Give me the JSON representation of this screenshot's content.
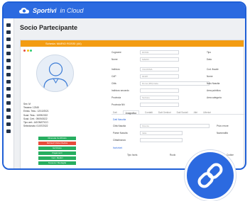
{
  "brand": {
    "name_bold": "Sportivi",
    "name_light": "in Cloud"
  },
  "page": {
    "title": "Socio Partecipante"
  },
  "panel": {
    "header": "Scheda: MARIO ROSSI (44)",
    "dot_colors": [
      "#e74c3c",
      "#f1c40f",
      "#2ecc71"
    ]
  },
  "profile": {
    "info": [
      "Sex: M",
      "Tessera: 12345",
      "Emiss. Tess.: 12/10/2021",
      "Scad. Tess.: 10/09/2022",
      "Scad. Cert.: 09/09/2022",
      "Tipo cert.: AGONISTICO",
      "Selezionato: 01/07/2022"
    ],
    "buttons": [
      {
        "label": "Ricevuta Certificato",
        "color": "#27ae60"
      },
      {
        "label": "Richiedi Visita Medica",
        "color": "#e74c3c"
      },
      {
        "label": "Iscrizione",
        "color": "#27ae60"
      },
      {
        "label": "Pagamenti",
        "color": "#27ae60"
      },
      {
        "label": "Cert. Medici",
        "color": "#27ae60"
      },
      {
        "label": "Tessera / Medaglia",
        "color": "#27ae60"
      }
    ]
  },
  "form": {
    "fields": [
      {
        "label": "Cognome",
        "value": "ROSSI"
      },
      {
        "label": "Nome",
        "value": "MARIO"
      },
      {
        "label": "Indirizzo",
        "value": "VIA ROMA"
      },
      {
        "label": "CAP",
        "value": "00187"
      },
      {
        "label": "Città",
        "value": "Roma (RM) Italia"
      },
      {
        "label": "Indirizzo secondo",
        "value": ""
      },
      {
        "label": "Provincia",
        "value": "Sezione"
      },
      {
        "label": "Provincia NN",
        "value": ""
      }
    ],
    "right_labels": [
      "Tipo",
      "Data",
      "Cod. fiscale",
      "Nome",
      "Nato Nascita",
      "Area pubblica",
      "Area categoria"
    ],
    "tabs": [
      "Dati",
      "Anagrafica",
      "Contatti",
      "Dati Genitori",
      "Dati Sociali",
      "Altri",
      "Ulteriori"
    ],
    "tab_active_index": 1,
    "section_title": "Dati Nascita",
    "lower_fields": [
      {
        "label": "Città Nascita",
        "value": "Firenze"
      },
      {
        "label": "Paese Nascita",
        "value": "Italia"
      },
      {
        "label": "Cittadinanza",
        "value": ""
      }
    ],
    "lower_right": [
      "Privo errore",
      "Nazionalità"
    ],
    "section_title_2": "Iscrizioni",
    "bottom_labels": [
      "Tipo Iscriz.",
      "Ruolo",
      "Codice"
    ]
  }
}
